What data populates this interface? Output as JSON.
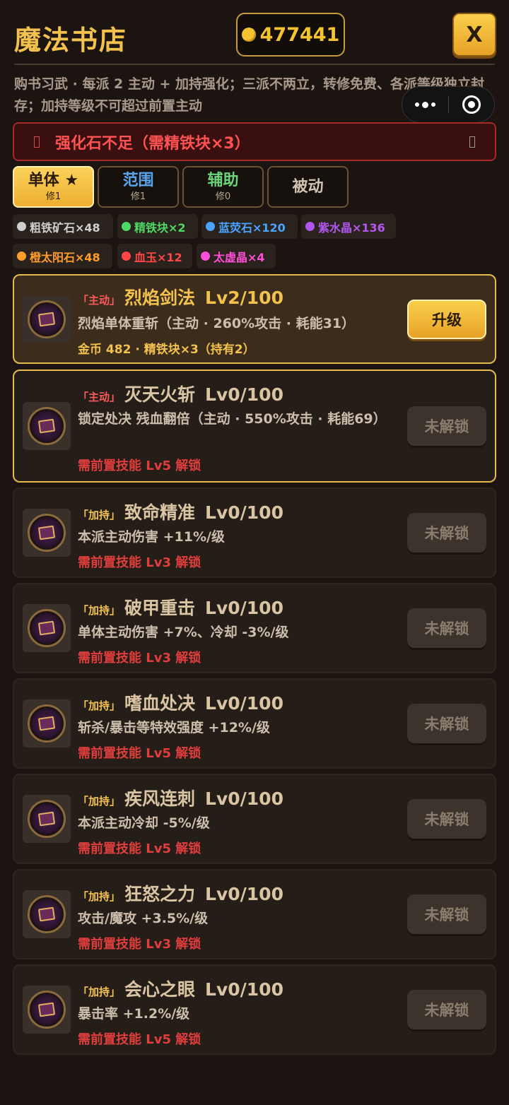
{
  "header": {
    "title": "魔法书店",
    "coins": "477441",
    "close_label": "X"
  },
  "description": "购书习武 · 每派 2 主动 + 加持强化；三派不两立，转修免费、各派等级独立封存；加持等级不可超过前置主动",
  "warning": "强化石不足（需精铁块×3）",
  "tabs": [
    {
      "label": "单体 ★",
      "sub": "修1",
      "color": "#2a1a08",
      "active": true
    },
    {
      "label": "范围",
      "sub": "修1",
      "color": "#58a6f0",
      "active": false
    },
    {
      "label": "辅助",
      "sub": "修0",
      "color": "#6bd47a",
      "active": false
    },
    {
      "label": "被动",
      "sub": "",
      "color": "#d0c4b4",
      "active": false
    }
  ],
  "materials": [
    {
      "label": "粗铁矿石×48",
      "color": "#cfcfcf"
    },
    {
      "label": "精铁块×2",
      "color": "#4cd964"
    },
    {
      "label": "蓝荧石×120",
      "color": "#4aa3ff"
    },
    {
      "label": "紫水晶×136",
      "color": "#b356f0"
    },
    {
      "label": "橙太阳石×48",
      "color": "#ff9c2a"
    },
    {
      "label": "血玉×12",
      "color": "#ff4545"
    },
    {
      "label": "太虚晶×4",
      "color": "#ff4fd8"
    }
  ],
  "skills": [
    {
      "tag": "「主动」",
      "tag_color": "#ff5a5a",
      "name": "烈焰剑法",
      "level": "Lv2/100",
      "desc": "烈焰单体重斩（主动 · 260%攻击 · 耗能31）",
      "cost": "金币 482 · 精铁块×3（持有2）",
      "button": "升级",
      "unlocked": true
    },
    {
      "tag": "「主动」",
      "tag_color": "#ff5a5a",
      "name": "灭天火斩",
      "level": "Lv0/100",
      "desc": "锁定处决 残血翻倍（主动 · 550%攻击 · 耗能69）",
      "requirement": "需前置技能 Lv5 解锁",
      "button": "未解锁",
      "unlocked": false
    },
    {
      "tag": "「加持」",
      "tag_color": "#f2c14e",
      "name": "致命精准",
      "level": "Lv0/100",
      "desc": "本派主动伤害 +11%/级",
      "requirement": "需前置技能 Lv3 解锁",
      "button": "未解锁",
      "unlocked": false
    },
    {
      "tag": "「加持」",
      "tag_color": "#f2c14e",
      "name": "破甲重击",
      "level": "Lv0/100",
      "desc": "单体主动伤害 +7%、冷却 -3%/级",
      "requirement": "需前置技能 Lv3 解锁",
      "button": "未解锁",
      "unlocked": false
    },
    {
      "tag": "「加持」",
      "tag_color": "#f2c14e",
      "name": "嗜血处决",
      "level": "Lv0/100",
      "desc": "斩杀/暴击等特效强度 +12%/级",
      "requirement": "需前置技能 Lv5 解锁",
      "button": "未解锁",
      "unlocked": false
    },
    {
      "tag": "「加持」",
      "tag_color": "#f2c14e",
      "name": "疾风连刺",
      "level": "Lv0/100",
      "desc": "本派主动冷却 -5%/级",
      "requirement": "需前置技能 Lv5 解锁",
      "button": "未解锁",
      "unlocked": false
    },
    {
      "tag": "「加持」",
      "tag_color": "#f2c14e",
      "name": "狂怒之力",
      "level": "Lv0/100",
      "desc": "攻击/魔攻 +3.5%/级",
      "requirement": "需前置技能 Lv3 解锁",
      "button": "未解锁",
      "unlocked": false
    },
    {
      "tag": "「加持」",
      "tag_color": "#f2c14e",
      "name": "会心之眼",
      "level": "Lv0/100",
      "desc": "暴击率 +1.2%/级",
      "requirement": "需前置技能 Lv5 解锁",
      "button": "未解锁",
      "unlocked": false
    }
  ]
}
